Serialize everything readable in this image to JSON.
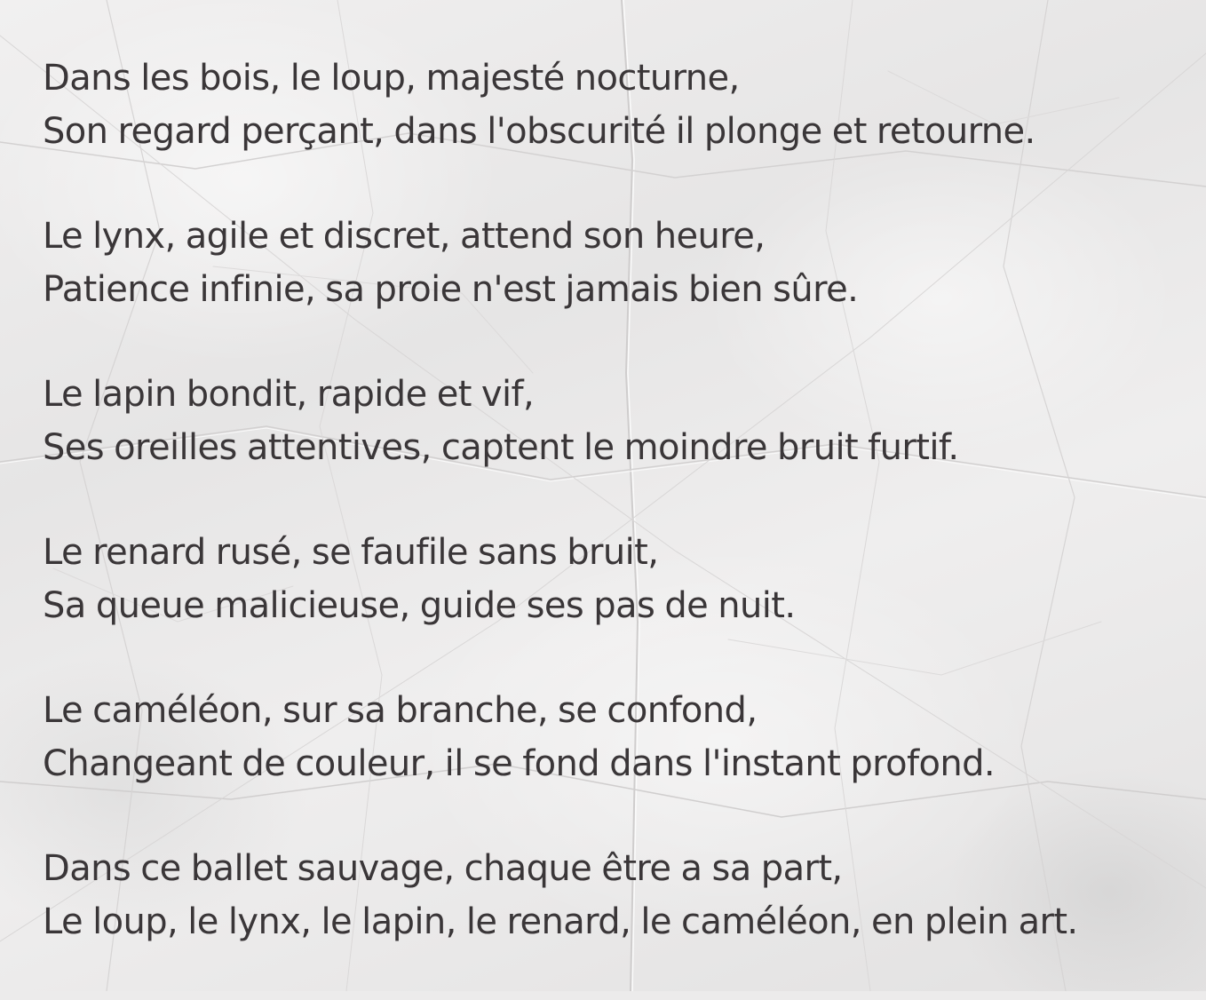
{
  "poem": {
    "stanzas": [
      {
        "line1": "Dans les bois, le loup, majesté nocturne,",
        "line2": "Son regard perçant, dans l'obscurité il plonge et retourne."
      },
      {
        "line1": "Le lynx, agile et discret, attend son heure,",
        "line2": "Patience infinie, sa proie n'est jamais bien sûre."
      },
      {
        "line1": "Le lapin bondit, rapide et vif,",
        "line2": "Ses oreilles attentives, captent le moindre bruit furtif."
      },
      {
        "line1": "Le renard rusé, se faufile sans bruit,",
        "line2": "Sa queue malicieuse, guide ses pas de nuit."
      },
      {
        "line1": "Le caméléon, sur sa branche, se confond,",
        "line2": "Changeant de couleur, il se fond dans l'instant profond."
      },
      {
        "line1": "Dans ce ballet sauvage, chaque être a sa part,",
        "line2": "Le loup, le lynx, le lapin, le renard, le caméléon, en plein art."
      }
    ]
  },
  "colors": {
    "text": "#3a3638",
    "paper": "#ecebeb"
  }
}
